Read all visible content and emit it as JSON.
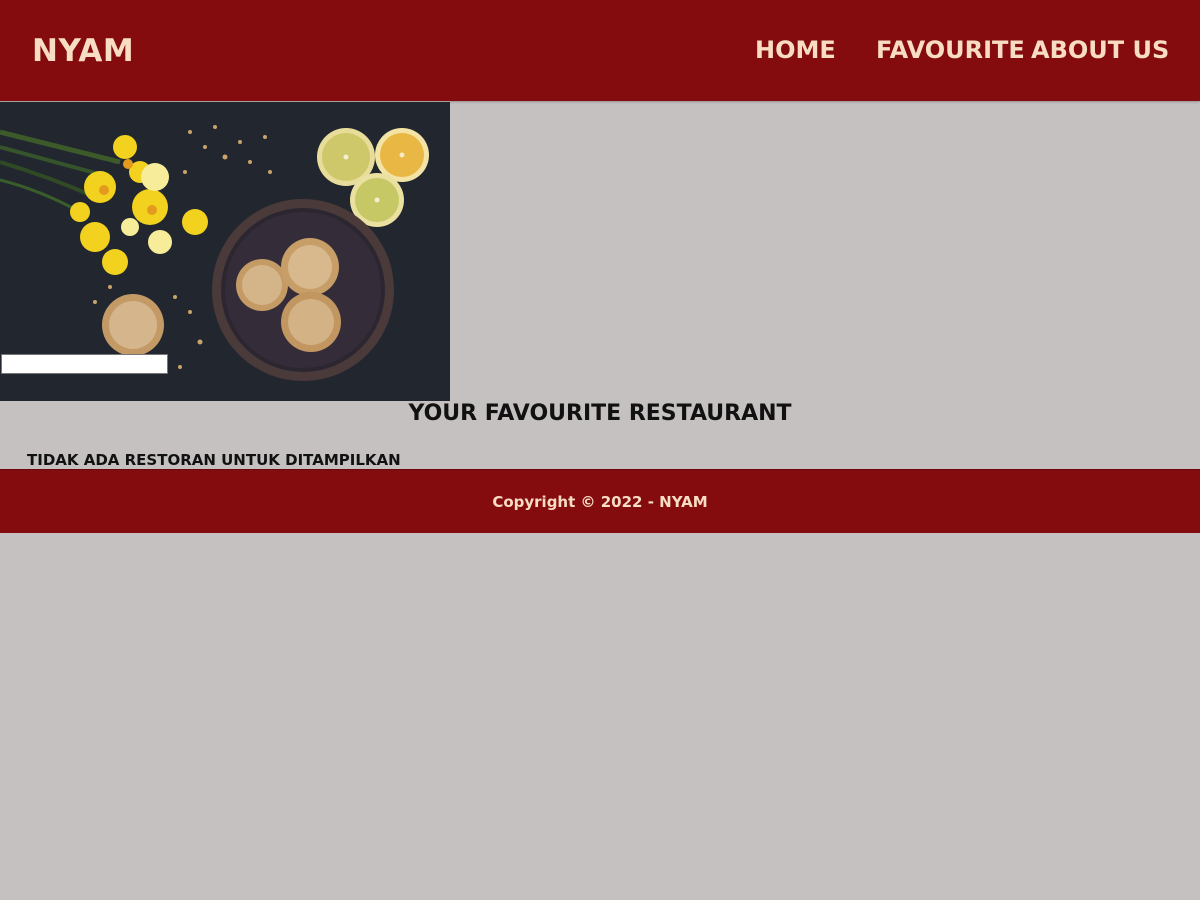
{
  "header": {
    "brand": "NYAM",
    "nav": {
      "home": "HOME",
      "favourite": "FAVOURITE",
      "about": "ABOUT US"
    }
  },
  "hero": {
    "search": {
      "value": "",
      "placeholder": ""
    }
  },
  "main": {
    "title": "YOUR FAVOURITE RESTAURANT",
    "empty_message": "TIDAK ADA RESTORAN UNTUK DITAMPILKAN"
  },
  "footer": {
    "copyright": "Copyright © 2022 - NYAM"
  },
  "colors": {
    "header_bg": "#840b0e",
    "header_text": "#f8dcc4",
    "page_bg": "#c5c1c0",
    "body_text": "#111111"
  }
}
